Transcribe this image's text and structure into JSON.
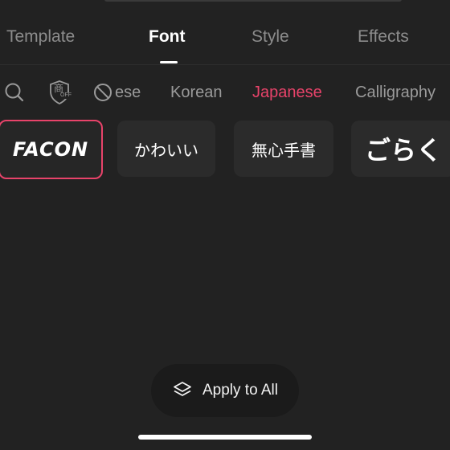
{
  "tabs": [
    {
      "label": "Template"
    },
    {
      "label": "Font"
    },
    {
      "label": "Style"
    },
    {
      "label": "Effects"
    }
  ],
  "active_tab": "Font",
  "filters": {
    "icons": [
      "search-icon",
      "commercial-off-icon",
      "no-entry-icon"
    ],
    "commercial_icon_text": {
      "main": "商",
      "sub": "OFF"
    },
    "items": [
      {
        "label": "ese"
      },
      {
        "label": "Korean"
      },
      {
        "label": "Japanese"
      },
      {
        "label": "Calligraphy"
      }
    ],
    "active": "Japanese"
  },
  "fonts": [
    {
      "label": "FACON",
      "selected": true
    },
    {
      "label": "かわいい",
      "selected": false
    },
    {
      "label": "無心手書",
      "selected": false
    },
    {
      "label": "ごらく",
      "selected": false
    }
  ],
  "apply_button": {
    "label": "Apply to All",
    "icon": "layers-icon"
  },
  "colors": {
    "background": "#222222",
    "accent": "#e8436a",
    "inactive_text": "#8c8c8c",
    "card_bg": "#2b2b2b"
  }
}
